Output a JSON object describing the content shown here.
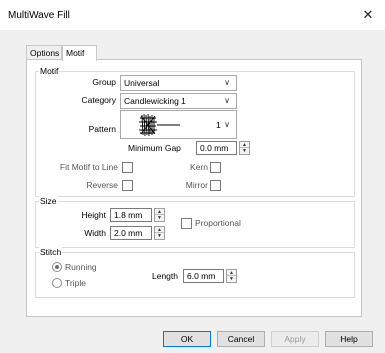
{
  "window": {
    "title": "MultiWave Fill",
    "close_glyph": "✕"
  },
  "tabs": [
    {
      "label": "Options"
    },
    {
      "label": "Motif"
    }
  ],
  "motif": {
    "group_title": "Motif",
    "group_label": "Group",
    "group_value": "Universal",
    "category_label": "Category",
    "category_value": "Candlewicking 1",
    "pattern_label": "Pattern",
    "pattern_value": "1",
    "min_gap_label": "Minimum Gap",
    "min_gap_value": "0.0 mm",
    "fit_label": "Fit Motif to Line",
    "kern_label": "Kern",
    "reverse_label": "Reverse",
    "mirror_label": "Mirror"
  },
  "size": {
    "group_title": "Size",
    "height_label": "Height",
    "height_value": "1.8 mm",
    "width_label": "Width",
    "width_value": "2.0 mm",
    "proportional_label": "Proportional"
  },
  "stitch": {
    "group_title": "Stitch",
    "running_label": "Running",
    "triple_label": "Triple",
    "selected": "Running",
    "length_label": "Length",
    "length_value": "6.0 mm"
  },
  "buttons": {
    "ok": "OK",
    "cancel": "Cancel",
    "apply": "Apply",
    "help": "Help"
  },
  "icons": {
    "dropdown": "chevron-down-icon",
    "spin": "spin-arrows-icon",
    "pattern_preview": "candlewick-motif-icon"
  }
}
